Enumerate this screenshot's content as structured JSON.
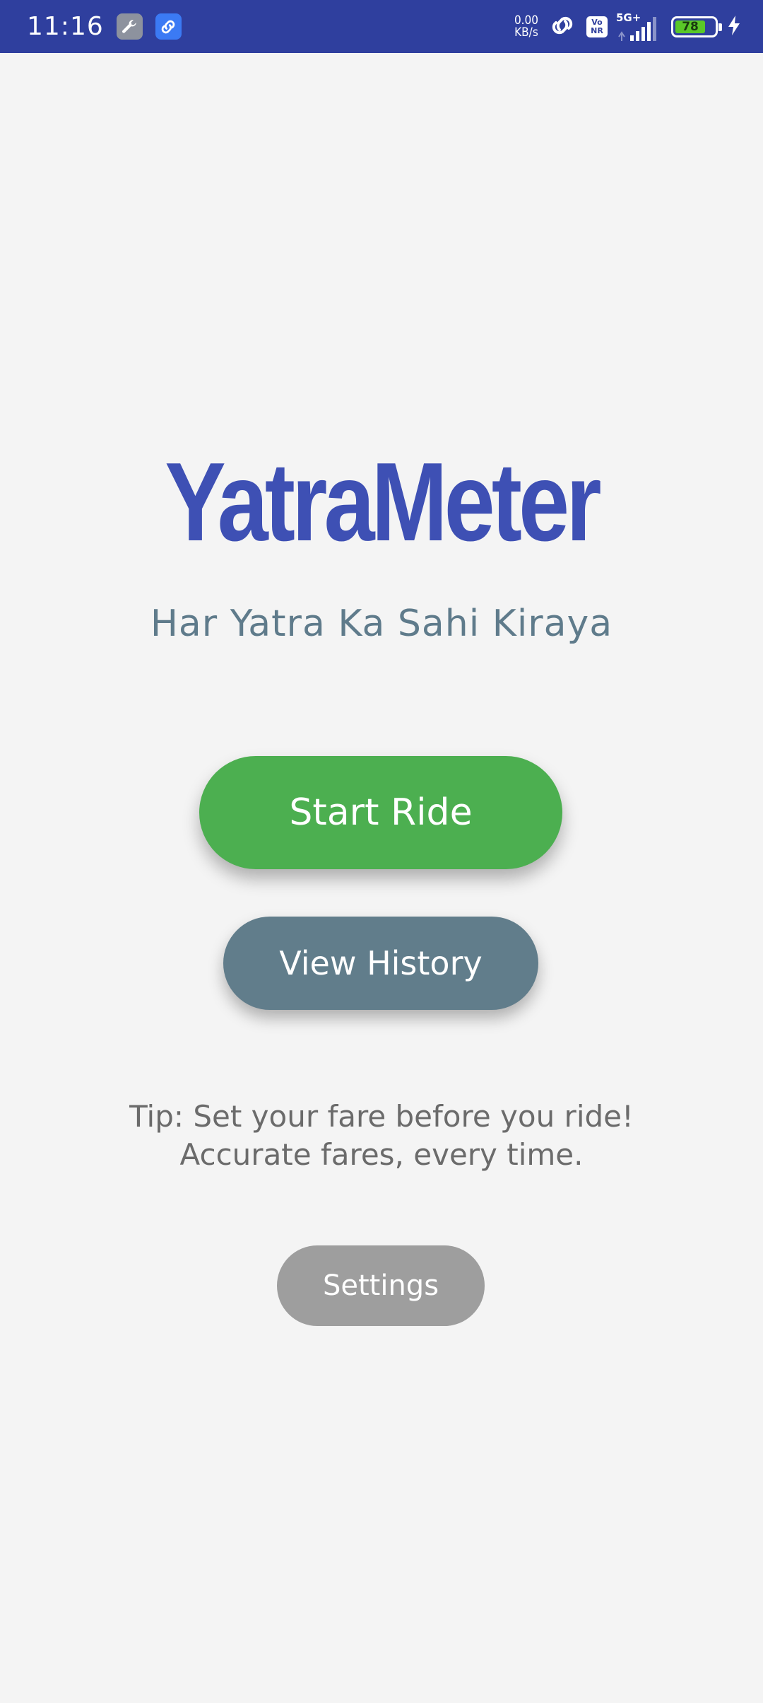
{
  "status_bar": {
    "time": "11:16",
    "net_speed_value": "0.00",
    "net_speed_unit": "KB/s",
    "volte_top": "Vo",
    "volte_bottom": "NR",
    "network_type": "5G+",
    "battery_level": "78",
    "battery_fraction": 0.78,
    "icons": [
      "wrench-icon",
      "link-icon",
      "hotspot-link-icon",
      "signal-icon",
      "charging-bolt-icon"
    ]
  },
  "app": {
    "title": "YatraMeter",
    "tagline": "Har Yatra Ka Sahi Kiraya",
    "start_button": "Start Ride",
    "history_button": "View History",
    "tip_line1": "Tip: Set your fare before you ride!",
    "tip_line2": "Accurate fares, every time.",
    "settings_button": "Settings"
  },
  "colors": {
    "status_bar": "#2f3f9e",
    "title": "#3e50b4",
    "tagline": "#5f7b8b",
    "start_button": "#4caf50",
    "history_button": "#617d8b",
    "settings_button": "#9e9e9e",
    "background": "#f4f4f4"
  }
}
